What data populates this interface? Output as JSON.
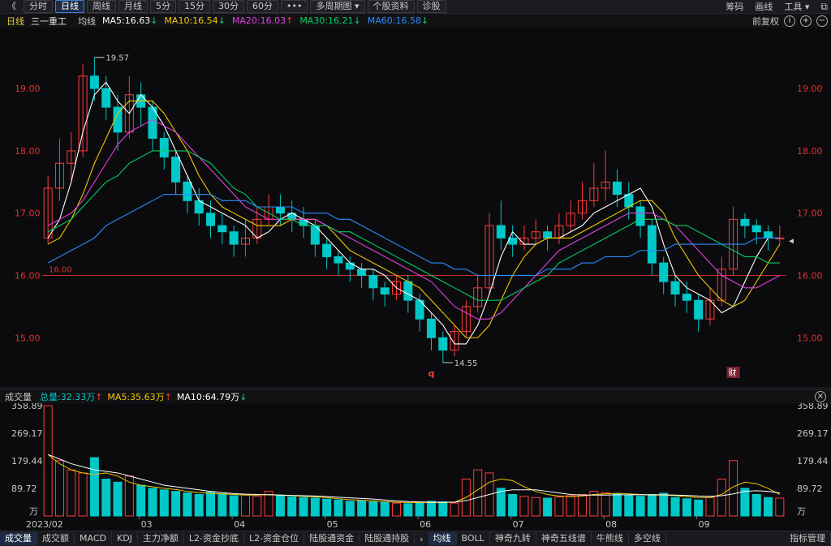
{
  "toolbar": {
    "back": "《",
    "items": [
      "分时",
      "日线",
      "周线",
      "月线",
      "5分",
      "15分",
      "30分",
      "60分",
      "•••",
      "多周期图 ▾",
      "个股资料",
      "诊股"
    ],
    "active_index": 1,
    "right": [
      "筹码",
      "画线",
      "工具 ▾"
    ]
  },
  "info": {
    "period": "日线",
    "name": "三一重工",
    "ma_label": "均线",
    "ma5": "MA5:16.63",
    "ma10": "MA10:16.54",
    "ma20": "MA20:16.03",
    "ma30": "MA30:16.21",
    "ma60": "MA60:16.58",
    "adjust": "前复权"
  },
  "colors": {
    "up": "#ff3b3b",
    "down": "#00c8c8",
    "ma5": "#ffffff",
    "ma10": "#f0c800",
    "ma20": "#e040e0",
    "ma30": "#00d060",
    "ma60": "#2a8cff",
    "price_axis": "#e03030"
  },
  "price_axis": {
    "ticks": [
      "19.00",
      "18.00",
      "17.00",
      "16.00",
      "15.00"
    ],
    "hline_label": "16.00",
    "max_label": "19.57",
    "min_label": "14.55",
    "markers": [
      "q",
      "财"
    ]
  },
  "volume": {
    "title": "成交量",
    "total": "总量:32.33万",
    "ma5": "MA5:35.63万",
    "ma10": "MA10:64.79万",
    "ticks": [
      "358.89",
      "269.17",
      "179.44",
      "89.72"
    ],
    "unit": "万"
  },
  "x_axis": [
    "2023/02",
    "03",
    "04",
    "05",
    "06",
    "07",
    "08",
    "09"
  ],
  "bottom_tabs_left": [
    "成交量",
    "成交额",
    "MACD",
    "KDJ",
    "主力净额",
    "L2-资金抄底",
    "L2-资金仓位",
    "陆股通资金",
    "陆股通持股"
  ],
  "bottom_tabs_right": [
    "均线",
    "BOLL",
    "神奇九转",
    "神奇五线谱",
    "牛熊线",
    "多空线",
    "指标管理"
  ],
  "chart_data": {
    "type": "candlestick",
    "ylim": [
      14.3,
      19.9
    ],
    "reference_line": 16.0,
    "ma_series": [
      {
        "name": "MA5",
        "values": [
          16.6,
          16.9,
          17.5,
          18.3,
          18.9,
          19.1,
          18.8,
          18.6,
          18.9,
          18.7,
          18.4,
          18.0,
          17.6,
          17.2,
          17.1,
          17.0,
          16.9,
          16.8,
          16.6,
          16.7,
          16.9,
          17.0,
          16.9,
          16.8,
          16.6,
          16.4,
          16.2,
          16.1,
          16.1,
          16.0,
          15.8,
          15.7,
          15.6,
          15.4,
          15.2,
          14.9,
          14.9,
          15.2,
          15.7,
          16.3,
          16.7,
          16.5,
          16.5,
          16.6,
          16.6,
          16.7,
          16.8,
          17.0,
          17.1,
          17.2,
          17.3,
          17.4,
          17.1,
          16.5,
          16.0,
          15.8,
          15.7,
          15.6,
          15.4,
          15.5,
          15.9,
          16.3,
          16.6,
          16.6
        ]
      },
      {
        "name": "MA10",
        "values": [
          16.5,
          16.6,
          16.9,
          17.3,
          17.8,
          18.2,
          18.6,
          18.8,
          18.8,
          18.8,
          18.6,
          18.3,
          18.0,
          17.6,
          17.3,
          17.1,
          17.0,
          16.9,
          16.8,
          16.8,
          16.8,
          16.9,
          16.9,
          16.9,
          16.8,
          16.6,
          16.4,
          16.3,
          16.2,
          16.1,
          16.0,
          15.9,
          15.8,
          15.6,
          15.4,
          15.2,
          15.0,
          15.0,
          15.2,
          15.6,
          16.0,
          16.3,
          16.5,
          16.6,
          16.6,
          16.6,
          16.7,
          16.8,
          16.9,
          17.0,
          17.1,
          17.2,
          17.2,
          17.0,
          16.6,
          16.3,
          16.0,
          15.8,
          15.6,
          15.5,
          15.6,
          15.9,
          16.2,
          16.5
        ]
      },
      {
        "name": "MA20",
        "values": [
          16.8,
          16.9,
          17.0,
          17.2,
          17.5,
          17.8,
          18.1,
          18.3,
          18.4,
          18.5,
          18.4,
          18.3,
          18.1,
          17.9,
          17.7,
          17.5,
          17.3,
          17.1,
          17.0,
          16.9,
          16.9,
          16.9,
          16.9,
          16.9,
          16.8,
          16.7,
          16.6,
          16.5,
          16.4,
          16.3,
          16.2,
          16.1,
          16.0,
          15.9,
          15.7,
          15.5,
          15.4,
          15.3,
          15.3,
          15.4,
          15.6,
          15.8,
          16.0,
          16.2,
          16.4,
          16.5,
          16.6,
          16.7,
          16.8,
          16.9,
          17.0,
          17.0,
          17.0,
          16.9,
          16.8,
          16.6,
          16.4,
          16.2,
          16.0,
          15.9,
          15.8,
          15.8,
          15.9,
          16.0
        ]
      },
      {
        "name": "MA30",
        "values": [
          16.7,
          16.8,
          16.9,
          17.1,
          17.3,
          17.5,
          17.6,
          17.8,
          17.9,
          18.0,
          18.0,
          18.0,
          18.0,
          17.9,
          17.8,
          17.6,
          17.4,
          17.3,
          17.1,
          17.0,
          16.9,
          16.9,
          16.8,
          16.8,
          16.8,
          16.7,
          16.7,
          16.6,
          16.5,
          16.4,
          16.3,
          16.2,
          16.1,
          16.0,
          15.9,
          15.8,
          15.7,
          15.6,
          15.6,
          15.6,
          15.7,
          15.8,
          15.9,
          16.0,
          16.2,
          16.3,
          16.4,
          16.5,
          16.6,
          16.7,
          16.8,
          16.9,
          16.9,
          16.9,
          16.8,
          16.8,
          16.7,
          16.6,
          16.5,
          16.4,
          16.3,
          16.3,
          16.2,
          16.2
        ]
      },
      {
        "name": "MA60",
        "values": [
          16.2,
          16.3,
          16.4,
          16.5,
          16.6,
          16.8,
          16.9,
          17.0,
          17.1,
          17.2,
          17.3,
          17.3,
          17.3,
          17.3,
          17.3,
          17.2,
          17.2,
          17.2,
          17.1,
          17.1,
          17.1,
          17.1,
          17.0,
          17.0,
          17.0,
          16.9,
          16.9,
          16.8,
          16.7,
          16.6,
          16.5,
          16.4,
          16.3,
          16.2,
          16.2,
          16.1,
          16.1,
          16.0,
          16.0,
          16.0,
          16.0,
          16.0,
          16.0,
          16.1,
          16.1,
          16.1,
          16.2,
          16.2,
          16.3,
          16.3,
          16.3,
          16.4,
          16.4,
          16.4,
          16.5,
          16.5,
          16.5,
          16.5,
          16.5,
          16.5,
          16.5,
          16.6,
          16.6,
          16.6
        ]
      }
    ],
    "candles": [
      [
        16.6,
        17.4,
        16.5,
        17.6
      ],
      [
        17.4,
        17.8,
        17.2,
        18.2
      ],
      [
        17.8,
        18.0,
        17.5,
        18.3
      ],
      [
        18.0,
        19.2,
        17.9,
        19.4
      ],
      [
        19.2,
        19.0,
        18.8,
        19.5
      ],
      [
        19.0,
        18.7,
        18.5,
        19.2
      ],
      [
        18.7,
        18.3,
        18.0,
        18.9
      ],
      [
        18.3,
        18.9,
        18.2,
        19.2
      ],
      [
        18.9,
        18.7,
        18.4,
        19.1
      ],
      [
        18.7,
        18.2,
        18.0,
        18.8
      ],
      [
        18.2,
        17.9,
        17.7,
        18.3
      ],
      [
        17.9,
        17.5,
        17.3,
        18.0
      ],
      [
        17.5,
        17.2,
        17.0,
        17.6
      ],
      [
        17.2,
        17.0,
        16.8,
        17.4
      ],
      [
        17.0,
        16.8,
        16.6,
        17.2
      ],
      [
        16.8,
        16.7,
        16.5,
        17.0
      ],
      [
        16.7,
        16.5,
        16.3,
        16.8
      ],
      [
        16.5,
        16.6,
        16.3,
        16.9
      ],
      [
        16.6,
        16.9,
        16.5,
        17.1
      ],
      [
        16.9,
        17.1,
        16.8,
        17.3
      ],
      [
        17.1,
        17.0,
        16.8,
        17.3
      ],
      [
        17.0,
        16.9,
        16.7,
        17.2
      ],
      [
        16.9,
        16.8,
        16.6,
        17.1
      ],
      [
        16.8,
        16.5,
        16.3,
        16.9
      ],
      [
        16.5,
        16.3,
        16.1,
        16.6
      ],
      [
        16.3,
        16.2,
        16.0,
        16.4
      ],
      [
        16.2,
        16.1,
        15.9,
        16.3
      ],
      [
        16.1,
        16.0,
        15.8,
        16.2
      ],
      [
        16.0,
        15.8,
        15.6,
        16.1
      ],
      [
        15.8,
        15.7,
        15.5,
        15.9
      ],
      [
        15.7,
        15.9,
        15.6,
        16.0
      ],
      [
        15.9,
        15.6,
        15.4,
        16.0
      ],
      [
        15.6,
        15.3,
        15.1,
        15.7
      ],
      [
        15.3,
        15.0,
        14.8,
        15.4
      ],
      [
        15.0,
        14.8,
        14.6,
        15.1
      ],
      [
        14.8,
        15.1,
        14.7,
        15.2
      ],
      [
        15.1,
        15.5,
        15.0,
        15.6
      ],
      [
        15.5,
        15.8,
        15.4,
        16.0
      ],
      [
        15.8,
        16.8,
        15.7,
        17.0
      ],
      [
        16.8,
        16.6,
        16.4,
        17.2
      ],
      [
        16.6,
        16.5,
        16.3,
        16.8
      ],
      [
        16.5,
        16.6,
        16.4,
        16.8
      ],
      [
        16.6,
        16.7,
        16.5,
        16.9
      ],
      [
        16.7,
        16.6,
        16.4,
        16.8
      ],
      [
        16.6,
        16.8,
        16.5,
        17.0
      ],
      [
        16.8,
        17.0,
        16.7,
        17.2
      ],
      [
        17.0,
        17.2,
        16.9,
        17.5
      ],
      [
        17.2,
        17.4,
        17.1,
        17.8
      ],
      [
        17.4,
        17.5,
        17.2,
        18.0
      ],
      [
        17.5,
        17.3,
        17.1,
        17.7
      ],
      [
        17.3,
        17.1,
        16.9,
        17.5
      ],
      [
        17.1,
        16.8,
        16.6,
        17.2
      ],
      [
        16.8,
        16.2,
        16.0,
        16.9
      ],
      [
        16.2,
        15.9,
        15.7,
        16.3
      ],
      [
        15.9,
        15.7,
        15.5,
        16.0
      ],
      [
        15.7,
        15.6,
        15.4,
        15.9
      ],
      [
        15.6,
        15.3,
        15.1,
        15.7
      ],
      [
        15.3,
        15.6,
        15.2,
        15.8
      ],
      [
        15.6,
        16.1,
        15.5,
        16.3
      ],
      [
        16.1,
        16.9,
        16.0,
        17.1
      ],
      [
        16.9,
        16.8,
        16.6,
        17.0
      ],
      [
        16.8,
        16.7,
        16.5,
        16.9
      ],
      [
        16.7,
        16.6,
        16.4,
        16.8
      ],
      [
        16.6,
        16.6,
        16.5,
        16.8
      ]
    ],
    "volumes": [
      358.9,
      180,
      150,
      140,
      190,
      120,
      110,
      130,
      100,
      90,
      85,
      80,
      75,
      70,
      78,
      72,
      66,
      70,
      64,
      80,
      68,
      62,
      60,
      58,
      55,
      52,
      48,
      50,
      46,
      44,
      42,
      40,
      44,
      48,
      46,
      42,
      120,
      150,
      140,
      90,
      70,
      64,
      60,
      58,
      62,
      66,
      70,
      80,
      76,
      72,
      68,
      64,
      70,
      74,
      60,
      56,
      52,
      60,
      120,
      180,
      90,
      70,
      60,
      58
    ],
    "vol_ma5": [
      200,
      170,
      150,
      140,
      135,
      140,
      130,
      110,
      100,
      95,
      90,
      86,
      80,
      76,
      74,
      72,
      70,
      68,
      68,
      70,
      68,
      66,
      64,
      62,
      60,
      56,
      53,
      51,
      49,
      47,
      45,
      44,
      44,
      44,
      44,
      45,
      60,
      85,
      110,
      120,
      115,
      95,
      80,
      70,
      65,
      63,
      65,
      70,
      72,
      74,
      72,
      70,
      68,
      68,
      66,
      63,
      60,
      60,
      70,
      95,
      110,
      105,
      90,
      70
    ],
    "vol_ma10": [
      200,
      185,
      170,
      160,
      150,
      145,
      140,
      130,
      120,
      110,
      100,
      95,
      90,
      85,
      80,
      76,
      73,
      71,
      70,
      69,
      68,
      67,
      66,
      65,
      63,
      61,
      59,
      57,
      55,
      52,
      49,
      47,
      46,
      45,
      45,
      45,
      50,
      60,
      70,
      80,
      85,
      85,
      85,
      80,
      75,
      70,
      68,
      68,
      68,
      69,
      69,
      69,
      69,
      69,
      68,
      67,
      65,
      64,
      66,
      72,
      80,
      82,
      80,
      75
    ]
  }
}
